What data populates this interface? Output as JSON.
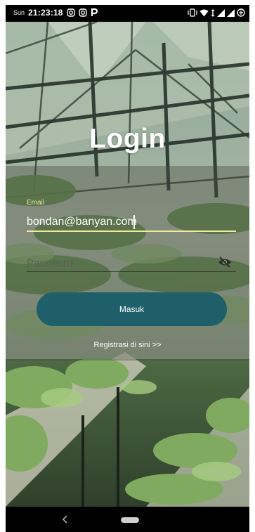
{
  "status_bar": {
    "day": "Sun",
    "time": "21:23:18",
    "left_icons": [
      "instagram-icon",
      "instagram-icon",
      "parking-icon"
    ],
    "right_icons": [
      "vibrate-icon",
      "wifi-icon",
      "data-arrows-icon",
      "signal-icon",
      "signal-icon",
      "battery-saver-icon"
    ]
  },
  "login": {
    "title": "Login",
    "email_label": "Email",
    "email_value": "bondan@banyan.com",
    "password_placeholder": "Password",
    "password_toggle_icon": "eye-off-icon",
    "submit_label": "Masuk",
    "register_link": "Registrasi di sini >>"
  },
  "colors": {
    "accent_underline": "#f2ea9a",
    "button": "#1f5f6a"
  },
  "nav_bar": {
    "icons": [
      "back-icon",
      "home-pill"
    ]
  }
}
